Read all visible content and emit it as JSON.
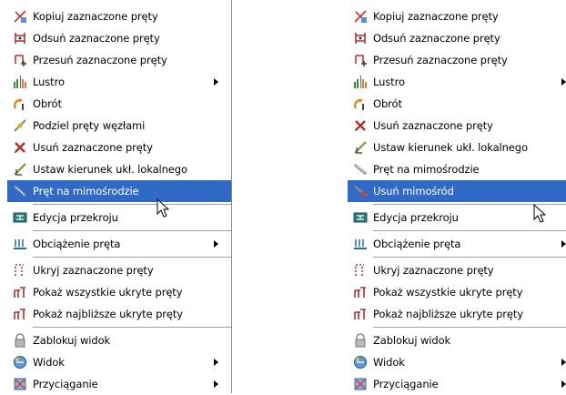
{
  "left_menu": {
    "items": [
      {
        "label": "Kopiuj zaznaczone pręty",
        "icon": "copy-bars-icon"
      },
      {
        "label": "Odsuń zaznaczone pręty",
        "icon": "offset-bars-icon"
      },
      {
        "label": "Przesuń zaznaczone pręty",
        "icon": "move-bars-icon"
      },
      {
        "label": "Lustro",
        "icon": "mirror-icon",
        "submenu": true
      },
      {
        "label": "Obrót",
        "icon": "rotate-icon"
      },
      {
        "label": "Podziel pręty węzłami",
        "icon": "divide-bars-icon"
      },
      {
        "label": "Usuń zaznaczone pręty",
        "icon": "delete-bars-icon"
      },
      {
        "label": "Ustaw kierunek ukł. lokalnego",
        "icon": "local-axes-icon"
      },
      {
        "label": "Pręt na mimośrodzie",
        "icon": "eccentric-bar-icon",
        "highlighted": true
      },
      {
        "label": "Edycja przekroju",
        "icon": "section-edit-icon"
      },
      {
        "label": "Obciążenie pręta",
        "icon": "bar-load-icon",
        "submenu": true
      },
      {
        "label": "Ukryj zaznaczone pręty",
        "icon": "hide-bars-icon"
      },
      {
        "label": "Pokaż wszystkie ukryte pręty",
        "icon": "show-all-bars-icon"
      },
      {
        "label": "Pokaż najbliższe ukryte pręty",
        "icon": "show-nearest-bars-icon"
      },
      {
        "label": "Zablokuj widok",
        "icon": "lock-view-icon"
      },
      {
        "label": "Widok",
        "icon": "view-icon",
        "submenu": true
      },
      {
        "label": "Przyciąganie",
        "icon": "snap-icon",
        "submenu": true
      }
    ]
  },
  "right_menu": {
    "items": [
      {
        "label": "Kopiuj zaznaczone pręty",
        "icon": "copy-bars-icon"
      },
      {
        "label": "Odsuń zaznaczone pręty",
        "icon": "offset-bars-icon"
      },
      {
        "label": "Przesuń zaznaczone pręty",
        "icon": "move-bars-icon"
      },
      {
        "label": "Lustro",
        "icon": "mirror-icon",
        "submenu": true
      },
      {
        "label": "Obrót",
        "icon": "rotate-icon"
      },
      {
        "label": "Usuń zaznaczone pręty",
        "icon": "delete-bars-icon"
      },
      {
        "label": "Ustaw kierunek ukł. lokalnego",
        "icon": "local-axes-icon"
      },
      {
        "label": "Pręt na mimośrodzie",
        "icon": "eccentric-bar-icon"
      },
      {
        "label": "Usuń mimośród",
        "icon": "remove-eccentricity-icon",
        "highlighted": true
      },
      {
        "label": "Edycja przekroju",
        "icon": "section-edit-icon"
      },
      {
        "label": "Obciążenie pręta",
        "icon": "bar-load-icon",
        "submenu": true
      },
      {
        "label": "Ukryj zaznaczone pręty",
        "icon": "hide-bars-icon"
      },
      {
        "label": "Pokaż wszystkie ukryte pręty",
        "icon": "show-all-bars-icon"
      },
      {
        "label": "Pokaż najbliższe ukryte pręty",
        "icon": "show-nearest-bars-icon"
      },
      {
        "label": "Zablokuj widok",
        "icon": "lock-view-icon"
      },
      {
        "label": "Widok",
        "icon": "view-icon",
        "submenu": true
      },
      {
        "label": "Przyciąganie",
        "icon": "snap-icon",
        "submenu": true
      }
    ]
  },
  "colors": {
    "highlight": "#316ac5",
    "separator": "#a0a0a0"
  }
}
